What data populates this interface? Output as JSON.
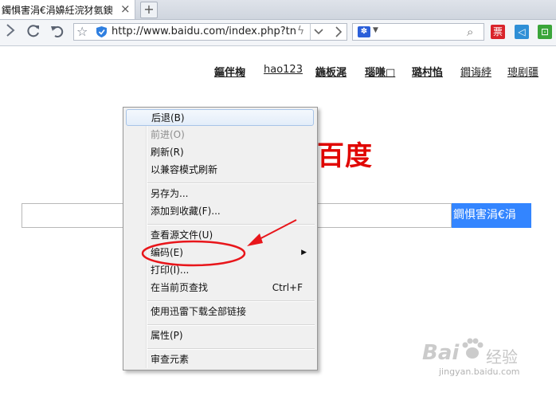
{
  "browser": {
    "tab_title": "鐲惧害涓€涓嬶紝浣犲氨鐭",
    "tab_close": "×",
    "new_tab": "+",
    "url": "http://www.baidu.com/index.php?tn=",
    "search_engine_icon": "paw-icon",
    "accent_color": "#2b5fd9"
  },
  "extensions": [
    {
      "name": "ticket-extension",
      "glyph": "票",
      "color": "#d9242b"
    },
    {
      "name": "bookmark-extension",
      "glyph": "◁",
      "color": "#2f8fd6"
    },
    {
      "name": "crop-extension",
      "glyph": "⊡",
      "color": "#3aa53a"
    }
  ],
  "page": {
    "nav_links": [
      "鏂伴椈",
      "hao123",
      "鍦板浘",
      "瑙嗛□",
      "璐村惂",
      "鐧诲綍",
      "璁剧疆"
    ],
    "logo": "百度",
    "logo_color": "#e10602",
    "search_button": "鐧惧害涓€涓",
    "search_button_color": "#3385ff"
  },
  "context_menu": {
    "items": [
      {
        "label": "后退(B)",
        "shortcut": "",
        "disabled": false,
        "highlighted": true,
        "submenu": false
      },
      {
        "label": "前进(O)",
        "shortcut": "",
        "disabled": true,
        "highlighted": false,
        "submenu": false
      },
      {
        "label": "刷新(R)",
        "shortcut": "",
        "disabled": false,
        "highlighted": false,
        "submenu": false
      },
      {
        "label": "以兼容模式刷新",
        "shortcut": "",
        "disabled": false,
        "highlighted": false,
        "submenu": false
      },
      {
        "label": "另存为...",
        "shortcut": "",
        "disabled": false,
        "highlighted": false,
        "submenu": false
      },
      {
        "label": "添加到收藏(F)...",
        "shortcut": "",
        "disabled": false,
        "highlighted": false,
        "submenu": false
      },
      {
        "label": "查看源文件(U)",
        "shortcut": "",
        "disabled": false,
        "highlighted": false,
        "submenu": false
      },
      {
        "label": "编码(E)",
        "shortcut": "",
        "disabled": false,
        "highlighted": false,
        "submenu": true
      },
      {
        "label": "打印(I)...",
        "shortcut": "",
        "disabled": false,
        "highlighted": false,
        "submenu": false
      },
      {
        "label": "在当前页查找",
        "shortcut": "Ctrl+F",
        "disabled": false,
        "highlighted": false,
        "submenu": false
      },
      {
        "label": "使用迅雷下载全部链接",
        "shortcut": "",
        "disabled": false,
        "highlighted": false,
        "submenu": false
      },
      {
        "label": "属性(P)",
        "shortcut": "",
        "disabled": false,
        "highlighted": false,
        "submenu": false
      },
      {
        "label": "审查元素",
        "shortcut": "",
        "disabled": false,
        "highlighted": false,
        "submenu": false
      }
    ]
  },
  "annotation_color": "#e8161b",
  "watermark": {
    "logo": "Bai",
    "jingyan": "经验",
    "url": "jingyan.baidu.com"
  }
}
